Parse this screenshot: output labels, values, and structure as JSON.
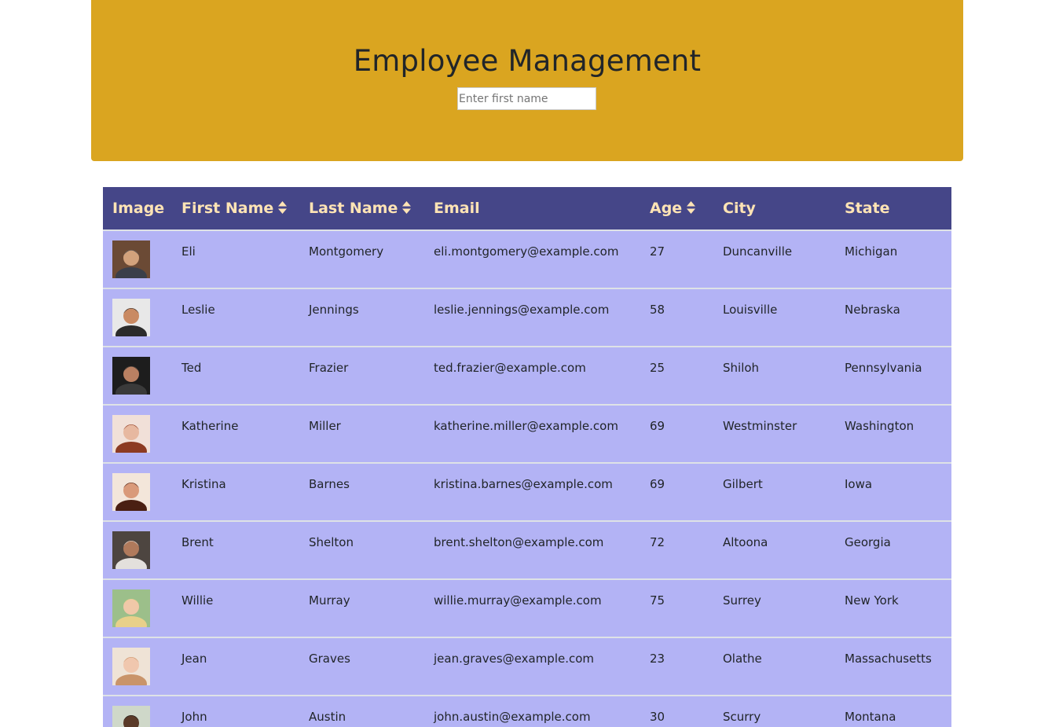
{
  "header": {
    "title": "Employee Management",
    "search_placeholder": "Enter first name",
    "background": "#daa520"
  },
  "table": {
    "header_background": "#454688",
    "header_text_color": "#ffe4b5",
    "row_background": "#b3b3f5",
    "columns": [
      {
        "label": "Image",
        "sortable": false
      },
      {
        "label": "First Name",
        "sortable": true
      },
      {
        "label": "Last Name",
        "sortable": true
      },
      {
        "label": "Email",
        "sortable": false
      },
      {
        "label": "Age",
        "sortable": true
      },
      {
        "label": "City",
        "sortable": false
      },
      {
        "label": "State",
        "sortable": false
      }
    ],
    "rows": [
      {
        "first": "Eli",
        "last": "Montgomery",
        "email": "eli.montgomery@example.com",
        "age": "27",
        "city": "Duncanville",
        "state": "Michigan",
        "photo": [
          "#6b4a35",
          "#3a3f4a",
          "#d2a27c"
        ]
      },
      {
        "first": "Leslie",
        "last": "Jennings",
        "email": "leslie.jennings@example.com",
        "age": "58",
        "city": "Louisville",
        "state": "Nebraska",
        "photo": [
          "#e8e8e8",
          "#2b2b2b",
          "#c98a63"
        ]
      },
      {
        "first": "Ted",
        "last": "Frazier",
        "email": "ted.frazier@example.com",
        "age": "25",
        "city": "Shiloh",
        "state": "Pennsylvania",
        "photo": [
          "#1d1d1d",
          "#3a3a3a",
          "#b98062"
        ]
      },
      {
        "first": "Katherine",
        "last": "Miller",
        "email": "katherine.miller@example.com",
        "age": "69",
        "city": "Westminster",
        "state": "Washington",
        "photo": [
          "#f1e0d8",
          "#8c3a22",
          "#e7b8a0"
        ]
      },
      {
        "first": "Kristina",
        "last": "Barnes",
        "email": "kristina.barnes@example.com",
        "age": "69",
        "city": "Gilbert",
        "state": "Iowa",
        "photo": [
          "#f3e6da",
          "#4a1f12",
          "#d99a7a"
        ]
      },
      {
        "first": "Brent",
        "last": "Shelton",
        "email": "brent.shelton@example.com",
        "age": "72",
        "city": "Altoona",
        "state": "Georgia",
        "photo": [
          "#4d4540",
          "#e3e0dc",
          "#b07a5c"
        ]
      },
      {
        "first": "Willie",
        "last": "Murray",
        "email": "willie.murray@example.com",
        "age": "75",
        "city": "Surrey",
        "state": "New York",
        "photo": [
          "#9cbf8a",
          "#e8d08a",
          "#f0c8a8"
        ]
      },
      {
        "first": "Jean",
        "last": "Graves",
        "email": "jean.graves@example.com",
        "age": "23",
        "city": "Olathe",
        "state": "Massachusetts",
        "photo": [
          "#efe3d6",
          "#c9946a",
          "#f0c7ae"
        ]
      },
      {
        "first": "John",
        "last": "Austin",
        "email": "john.austin@example.com",
        "age": "30",
        "city": "Scurry",
        "state": "Montana",
        "photo": [
          "#cfd8c9",
          "#1a1a1a",
          "#5a3a28"
        ]
      }
    ]
  }
}
